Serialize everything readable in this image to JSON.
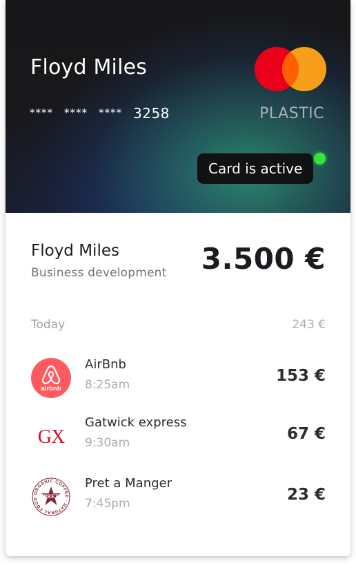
{
  "card": {
    "holder_name": "Floyd Miles",
    "number_mask": [
      "****",
      "****",
      "****"
    ],
    "last4": "3258",
    "type": "PLASTIC",
    "brand": "mastercard-logo",
    "status": "Card is active",
    "status_color": "#36e23c",
    "brand_colors": {
      "left": "#eb001b",
      "right": "#f79e1b",
      "overlap": "#ff5f00"
    }
  },
  "summary": {
    "name": "Floyd Miles",
    "role": "Business development",
    "balance": "3.500 €"
  },
  "day_group": {
    "label": "Today",
    "total": "243 €"
  },
  "transactions": [
    {
      "merchant": "AirBnb",
      "time": "8:25am",
      "amount": "153 €",
      "logo": "airbnb-logo",
      "logo_text": "airbnb",
      "color": "#ff5a5f"
    },
    {
      "merchant": "Gatwick express",
      "time": "9:30am",
      "amount": "67 €",
      "logo": "gatwick-express-logo",
      "logo_text": "GX",
      "color": "#c8102e"
    },
    {
      "merchant": "Pret a Manger",
      "time": "7:45pm",
      "amount": "23 €",
      "logo": "pret-a-manger-logo",
      "logo_text": "ORGANIC COFFEE NATURAL FOOD PRET",
      "color": "#862633"
    }
  ]
}
